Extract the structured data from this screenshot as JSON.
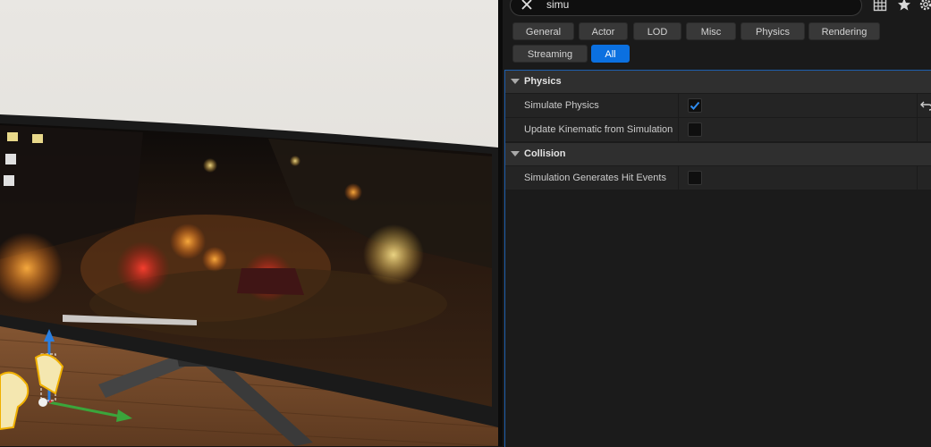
{
  "search": {
    "value": "simu",
    "clear_icon": "close-icon",
    "table_icon": "table-view-icon",
    "favorite_icon": "star-icon",
    "settings_icon": "gear-icon"
  },
  "filters": [
    {
      "label": "General",
      "active": false
    },
    {
      "label": "Actor",
      "active": false
    },
    {
      "label": "LOD",
      "active": false
    },
    {
      "label": "Misc",
      "active": false
    },
    {
      "label": "Physics",
      "active": false
    },
    {
      "label": "Rendering",
      "active": false
    },
    {
      "label": "Streaming",
      "active": false
    },
    {
      "label": "All",
      "active": true
    }
  ],
  "categories": [
    {
      "label": "Physics",
      "properties": [
        {
          "label": "Simulate Physics",
          "checked": true,
          "has_reset": true
        },
        {
          "label": "Update Kinematic from Simulation",
          "checked": false,
          "has_reset": false
        }
      ]
    },
    {
      "label": "Collision",
      "properties": [
        {
          "label": "Simulation Generates Hit Events",
          "checked": false,
          "has_reset": false
        }
      ]
    }
  ],
  "colors": {
    "accent": "#0b70e0",
    "panel_bg": "#1a1a1a",
    "category_bg": "#2f2f2f",
    "row_bg": "#242424"
  }
}
